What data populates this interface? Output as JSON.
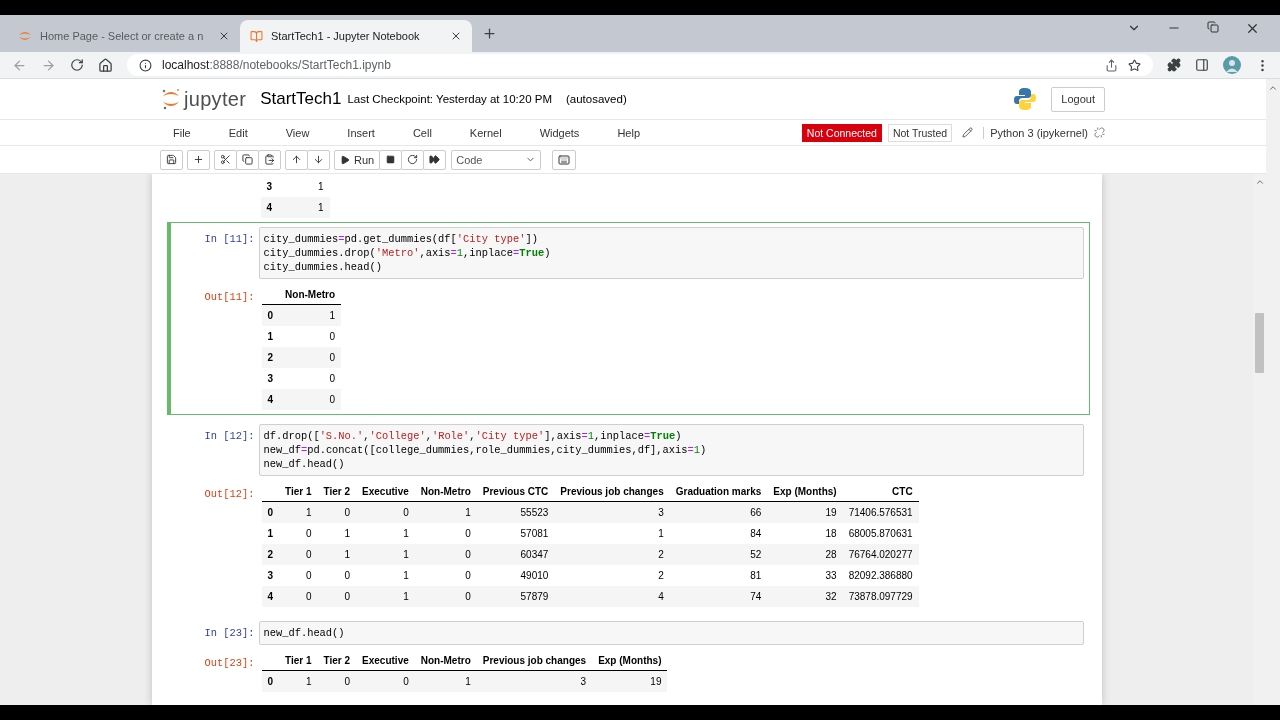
{
  "browser": {
    "tabs": [
      {
        "title": "Home Page - Select or create a n",
        "selected": false
      },
      {
        "title": "StartTech1 - Jupyter Notebook",
        "selected": true
      }
    ],
    "url": {
      "host": "localhost",
      "rest": ":8888/notebooks/StartTech1.ipynb"
    }
  },
  "header": {
    "logo": "jupyter",
    "notebook_name": "StartTech1",
    "checkpoint": "Last Checkpoint: Yesterday at 10:20 PM",
    "autosave": "(autosaved)",
    "logout": "Logout"
  },
  "menu": [
    "File",
    "Edit",
    "View",
    "Insert",
    "Cell",
    "Kernel",
    "Widgets",
    "Help"
  ],
  "kernel_status": {
    "connection": "Not Connected",
    "trust": "Not Trusted",
    "kernel": "Python 3 (ipykernel)"
  },
  "toolbar": {
    "run": "Run",
    "cell_type": "Code"
  },
  "cells": [
    {
      "kind": "output",
      "output": {
        "rows": [
          {
            "index": "3",
            "values": [
              "1"
            ]
          },
          {
            "index": "4",
            "values": [
              "1"
            ]
          }
        ]
      }
    },
    {
      "kind": "code",
      "selected": true,
      "prompt": "In [11]:",
      "code": [
        [
          {
            "text": "city_dummies",
            "kind": "text"
          },
          {
            "text": "=",
            "kind": "op"
          },
          {
            "text": "pd.get_dummies(df[",
            "kind": "text"
          },
          {
            "text": "'City type'",
            "kind": "str"
          },
          {
            "text": "])",
            "kind": "text"
          }
        ],
        [
          {
            "text": "city_dummies.drop(",
            "kind": "text"
          },
          {
            "text": "'Metro'",
            "kind": "str"
          },
          {
            "text": ",axis",
            "kind": "text"
          },
          {
            "text": "=",
            "kind": "op"
          },
          {
            "text": "1",
            "kind": "num"
          },
          {
            "text": ",inplace",
            "kind": "text"
          },
          {
            "text": "=",
            "kind": "op"
          },
          {
            "text": "True",
            "kind": "kw"
          },
          {
            "text": ")",
            "kind": "text"
          }
        ],
        [
          {
            "text": "city_dummies.head()",
            "kind": "text"
          }
        ]
      ],
      "out_prompt": "Out[11]:",
      "output": {
        "columns": [
          "Non-Metro"
        ],
        "rows": [
          {
            "index": "0",
            "values": [
              "1"
            ]
          },
          {
            "index": "1",
            "values": [
              "0"
            ]
          },
          {
            "index": "2",
            "values": [
              "0"
            ]
          },
          {
            "index": "3",
            "values": [
              "0"
            ]
          },
          {
            "index": "4",
            "values": [
              "0"
            ]
          }
        ]
      }
    },
    {
      "kind": "code",
      "selected": false,
      "prompt": "In [12]:",
      "code": [
        [
          {
            "text": "df.drop([",
            "kind": "text"
          },
          {
            "text": "'S.No.'",
            "kind": "str"
          },
          {
            "text": ",",
            "kind": "text"
          },
          {
            "text": "'College'",
            "kind": "str"
          },
          {
            "text": ",",
            "kind": "text"
          },
          {
            "text": "'Role'",
            "kind": "str"
          },
          {
            "text": ",",
            "kind": "text"
          },
          {
            "text": "'City type'",
            "kind": "str"
          },
          {
            "text": "],axis",
            "kind": "text"
          },
          {
            "text": "=",
            "kind": "op"
          },
          {
            "text": "1",
            "kind": "num"
          },
          {
            "text": ",inplace",
            "kind": "text"
          },
          {
            "text": "=",
            "kind": "op"
          },
          {
            "text": "True",
            "kind": "kw"
          },
          {
            "text": ")",
            "kind": "text"
          }
        ],
        [
          {
            "text": "new_df",
            "kind": "text"
          },
          {
            "text": "=",
            "kind": "op"
          },
          {
            "text": "pd.concat([college_dummies,role_dummies,city_dummies,df],axis",
            "kind": "text"
          },
          {
            "text": "=",
            "kind": "op"
          },
          {
            "text": "1",
            "kind": "num"
          },
          {
            "text": ")",
            "kind": "text"
          }
        ],
        [
          {
            "text": "new_df.head()",
            "kind": "text"
          }
        ]
      ],
      "out_prompt": "Out[12]:",
      "output": {
        "columns": [
          "Tier 1",
          "Tier 2",
          "Executive",
          "Non-Metro",
          "Previous CTC",
          "Previous job changes",
          "Graduation marks",
          "Exp (Months)",
          "CTC"
        ],
        "rows": [
          {
            "index": "0",
            "values": [
              "1",
              "0",
              "0",
              "1",
              "55523",
              "3",
              "66",
              "19",
              "71406.576531"
            ]
          },
          {
            "index": "1",
            "values": [
              "0",
              "1",
              "1",
              "0",
              "57081",
              "1",
              "84",
              "18",
              "68005.870631"
            ]
          },
          {
            "index": "2",
            "values": [
              "0",
              "1",
              "1",
              "0",
              "60347",
              "2",
              "52",
              "28",
              "76764.020277"
            ]
          },
          {
            "index": "3",
            "values": [
              "0",
              "0",
              "1",
              "0",
              "49010",
              "2",
              "81",
              "33",
              "82092.386880"
            ]
          },
          {
            "index": "4",
            "values": [
              "0",
              "0",
              "1",
              "0",
              "57879",
              "4",
              "74",
              "32",
              "73878.097729"
            ]
          }
        ]
      }
    },
    {
      "kind": "code",
      "selected": false,
      "prompt": "In [23]:",
      "code": [
        [
          {
            "text": "new_df.head()",
            "kind": "text"
          }
        ]
      ],
      "out_prompt": "Out[23]:",
      "output": {
        "columns": [
          "Tier 1",
          "Tier 2",
          "Executive",
          "Non-Metro",
          "Previous job changes",
          "Exp (Months)"
        ],
        "rows": [
          {
            "index": "0",
            "values": [
              "1",
              "0",
              "0",
              "1",
              "3",
              "19"
            ]
          }
        ]
      }
    }
  ]
}
